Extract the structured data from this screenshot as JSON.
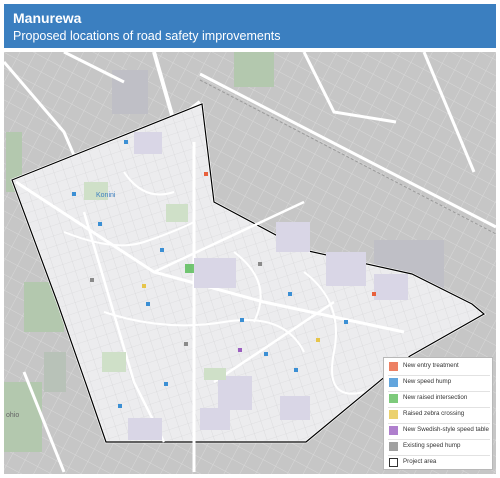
{
  "header": {
    "title": "Manurewa",
    "subtitle": "Proposed locations of road safety improvements",
    "background_color": "#3b7fc0"
  },
  "map": {
    "place_labels": [
      "Konini",
      "ohio"
    ],
    "project_area_fill": "#e8e8ea",
    "outside_fill": "#c9c9c9"
  },
  "legend": {
    "items": [
      {
        "label": "New entry treatment",
        "color": "#e8603c",
        "icon": "cross-hatch-swatch"
      },
      {
        "label": "New speed hump",
        "color": "#3b8fd4",
        "icon": "cross-hatch-swatch"
      },
      {
        "label": "New raised intersection",
        "color": "#5cbd5a",
        "icon": "cross-hatch-swatch"
      },
      {
        "label": "Raised zebra crossing",
        "color": "#e6c54a",
        "icon": "cross-hatch-swatch"
      },
      {
        "label": "New Swedish-style speed table",
        "color": "#9b5fc0",
        "icon": "cross-hatch-swatch"
      },
      {
        "label": "Existing speed hump",
        "color": "#8a8a8a",
        "icon": "cross-hatch-swatch"
      },
      {
        "label": "Project area",
        "color": "#ffffff",
        "icon": "outline-swatch"
      }
    ]
  }
}
